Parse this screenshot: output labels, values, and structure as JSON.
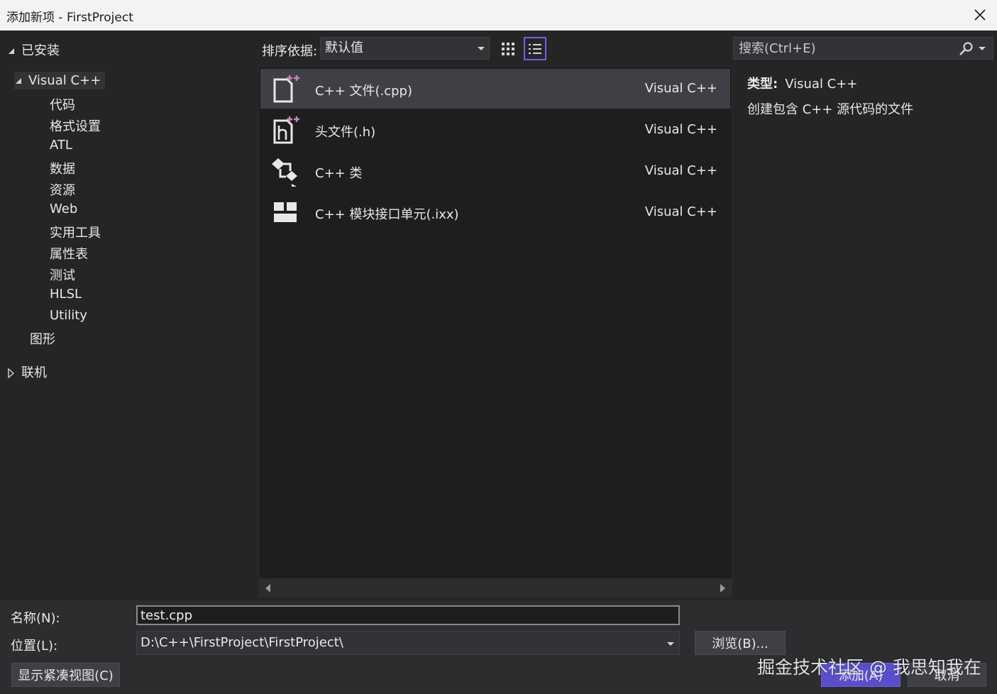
{
  "window": {
    "title": "添加新项 - FirstProject"
  },
  "tree": {
    "installed": "已安装",
    "visual_cpp": "Visual C++",
    "children": [
      "代码",
      "格式设置",
      "ATL",
      "数据",
      "资源",
      "Web",
      "实用工具",
      "属性表",
      "测试",
      "HLSL",
      "Utility"
    ],
    "graphics": "图形",
    "online": "联机"
  },
  "toolbar": {
    "sort_label": "排序依据:",
    "sort_value": "默认值",
    "search_placeholder": "搜索(Ctrl+E)"
  },
  "templates": [
    {
      "name": "C++ 文件(.cpp)",
      "language": "Visual C++",
      "icon": "cpp-file-icon",
      "selected": true
    },
    {
      "name": "头文件(.h)",
      "language": "Visual C++",
      "icon": "header-file-icon",
      "selected": false
    },
    {
      "name": "C++ 类",
      "language": "Visual C++",
      "icon": "cpp-class-icon",
      "selected": false
    },
    {
      "name": "C++ 模块接口单元(.ixx)",
      "language": "Visual C++",
      "icon": "module-interface-icon",
      "selected": false
    }
  ],
  "details": {
    "type_label": "类型:",
    "type_value": "Visual C++",
    "description": "创建包含 C++ 源代码的文件"
  },
  "form": {
    "name_label": "名称(N):",
    "name_value": "test.cpp",
    "location_label": "位置(L):",
    "location_value": "D:\\C++\\FirstProject\\FirstProject\\",
    "browse_label": "浏览(B)...",
    "compact_label": "显示紧凑视图(C)",
    "add_label": "添加(A)",
    "cancel_label": "取消"
  },
  "watermark": "掘金技术社区 @ 我思知我在",
  "colors": {
    "accent": "#7160e8",
    "icon_plus": "#c586c0",
    "background": "#252526",
    "list_background": "#1e1e1e"
  }
}
